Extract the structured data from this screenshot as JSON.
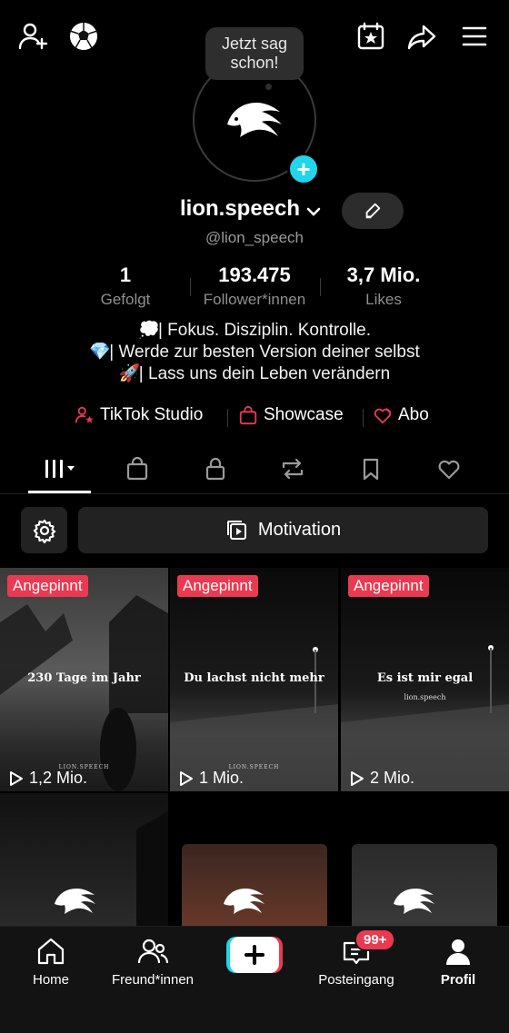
{
  "speech_bubble": "Jetzt sag schon!",
  "profile": {
    "username": "lion.speech",
    "handle": "@lion_speech",
    "edit_icon": "pencil-icon"
  },
  "stats": [
    {
      "value": "1",
      "label": "Gefolgt"
    },
    {
      "value": "193.475",
      "label": "Follower*innen"
    },
    {
      "value": "3,7 Mio.",
      "label": "Likes"
    }
  ],
  "bio": [
    {
      "emoji": "💭",
      "text": "| Fokus. Disziplin. Kontrolle."
    },
    {
      "emoji": "💎",
      "text": "| Werde zur besten Version deiner selbst"
    },
    {
      "emoji": "🚀",
      "text": "| Lass uns dein Leben verändern"
    }
  ],
  "links": [
    {
      "label": "TikTok Studio",
      "icon": "person-star-icon"
    },
    {
      "label": "Showcase",
      "icon": "shopping-bag-icon"
    },
    {
      "label": "Abo",
      "icon": "subscription-icon"
    }
  ],
  "tabs": [
    {
      "name": "videos-grid",
      "icon": "grid-icon"
    },
    {
      "name": "shop",
      "icon": "bag-icon"
    },
    {
      "name": "private",
      "icon": "lock-icon"
    },
    {
      "name": "reposts",
      "icon": "repost-icon"
    },
    {
      "name": "favorites",
      "icon": "bookmark-icon"
    },
    {
      "name": "liked",
      "icon": "heart-icon"
    }
  ],
  "playlist": {
    "label": "Motivation"
  },
  "videos": [
    {
      "pinned": "Angepinnt",
      "title": "230 Tage im Jahr",
      "sub": "",
      "mark": "LION.SPEECH",
      "views": "1,2 Mio."
    },
    {
      "pinned": "Angepinnt",
      "title": "Du lachst nicht mehr",
      "sub": "",
      "mark": "LION.SPEECH",
      "views": "1 Mio."
    },
    {
      "pinned": "Angepinnt",
      "title": "Es ist mir egal",
      "sub": "lion.speech",
      "mark": "",
      "views": "2 Mio."
    }
  ],
  "bottom_nav": {
    "home": "Home",
    "friends": "Freund*innen",
    "inbox": "Posteingang",
    "inbox_badge": "99+",
    "profile": "Profil"
  },
  "colors": {
    "accent_red": "#ea3a52",
    "accent_cyan": "#20d5ec",
    "background": "#000000"
  }
}
